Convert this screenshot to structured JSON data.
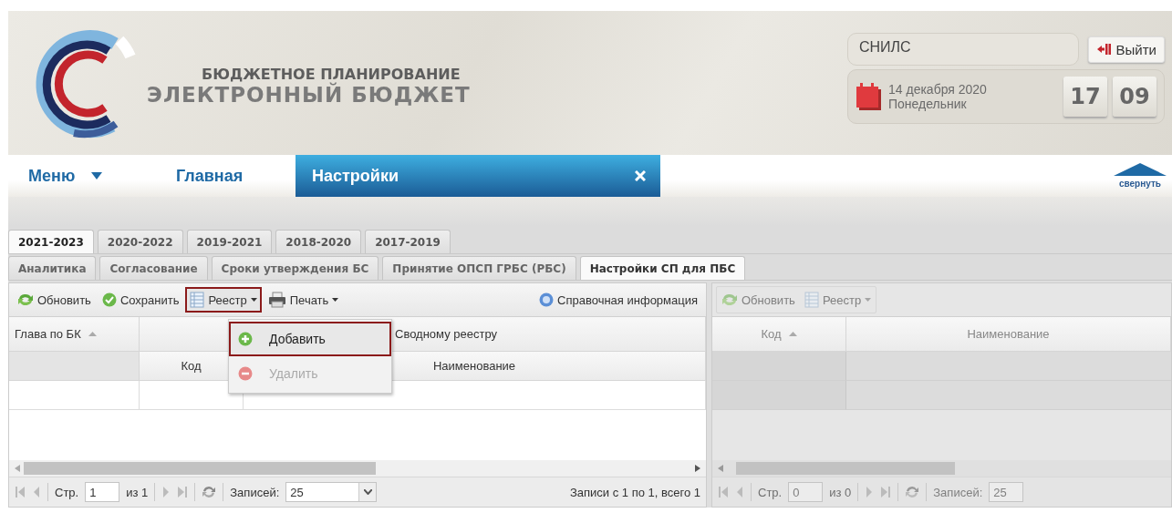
{
  "header": {
    "title_top": "БЮДЖЕТНОЕ ПЛАНИРОВАНИЕ",
    "title_main": "ЭЛЕКТРОННЫЙ БЮДЖЕТ",
    "user": "СНИЛС",
    "logout": "Выйти",
    "date": "14 декабря 2020",
    "weekday": "Понедельник",
    "hours": "17",
    "minutes": "09"
  },
  "nav": {
    "menu": "Меню",
    "collapse": "свернуть",
    "tabs": [
      {
        "label": "Главная",
        "selected": false,
        "closable": false
      },
      {
        "label": "Настройки",
        "selected": true,
        "closable": true
      }
    ]
  },
  "year_tabs": [
    {
      "label": "2021-2023",
      "selected": true
    },
    {
      "label": "2020-2022",
      "selected": false
    },
    {
      "label": "2019-2021",
      "selected": false
    },
    {
      "label": "2018-2020",
      "selected": false
    },
    {
      "label": "2017-2019",
      "selected": false
    }
  ],
  "sub_tabs": [
    {
      "label": "Аналитика",
      "selected": false
    },
    {
      "label": "Согласование",
      "selected": false
    },
    {
      "label": "Сроки утверждения БС",
      "selected": false
    },
    {
      "label": "Принятие ОПСП ГРБС (РБС)",
      "selected": false
    },
    {
      "label": "Настройки СП для ПБС",
      "selected": true
    }
  ],
  "left_panel": {
    "disabled": false,
    "toolbar": [
      {
        "kind": "refresh",
        "label": "Обновить",
        "dropdown": false,
        "outlined": false
      },
      {
        "kind": "save",
        "label": "Сохранить",
        "dropdown": false,
        "outlined": false
      },
      {
        "kind": "table",
        "label": "Реестр",
        "dropdown": true,
        "outlined": true
      },
      {
        "kind": "print",
        "label": "Печать",
        "dropdown": true,
        "outlined": false
      },
      {
        "kind": "help",
        "label": "Справочная информация",
        "dropdown": false,
        "outlined": false
      }
    ],
    "menu": [
      {
        "kind": "add",
        "label": "Добавить",
        "disabled": false,
        "outlined": true
      },
      {
        "kind": "remove",
        "label": "Удалить",
        "disabled": true,
        "outlined": false
      }
    ],
    "grid": {
      "first_column": "Глава по БК",
      "group": "Сводному реестру",
      "columns": [
        "Код",
        "Наименование"
      ]
    },
    "paging": {
      "page_label": "Стр.",
      "page": "1",
      "of": "из 1",
      "size_label": "Записей:",
      "size": "25",
      "summary": "Записи с 1 по 1, всего 1"
    }
  },
  "right_panel": {
    "disabled": true,
    "toolbar": [
      {
        "kind": "refresh",
        "label": "Обновить",
        "dropdown": false,
        "outlined": false
      },
      {
        "kind": "table",
        "label": "Реестр",
        "dropdown": true,
        "outlined": false
      }
    ],
    "columns": [
      "Код",
      "Наименование"
    ],
    "paging": {
      "page_label": "Стр.",
      "page": "0",
      "of": "из 0",
      "size_label": "Записей:",
      "size": "25"
    }
  }
}
